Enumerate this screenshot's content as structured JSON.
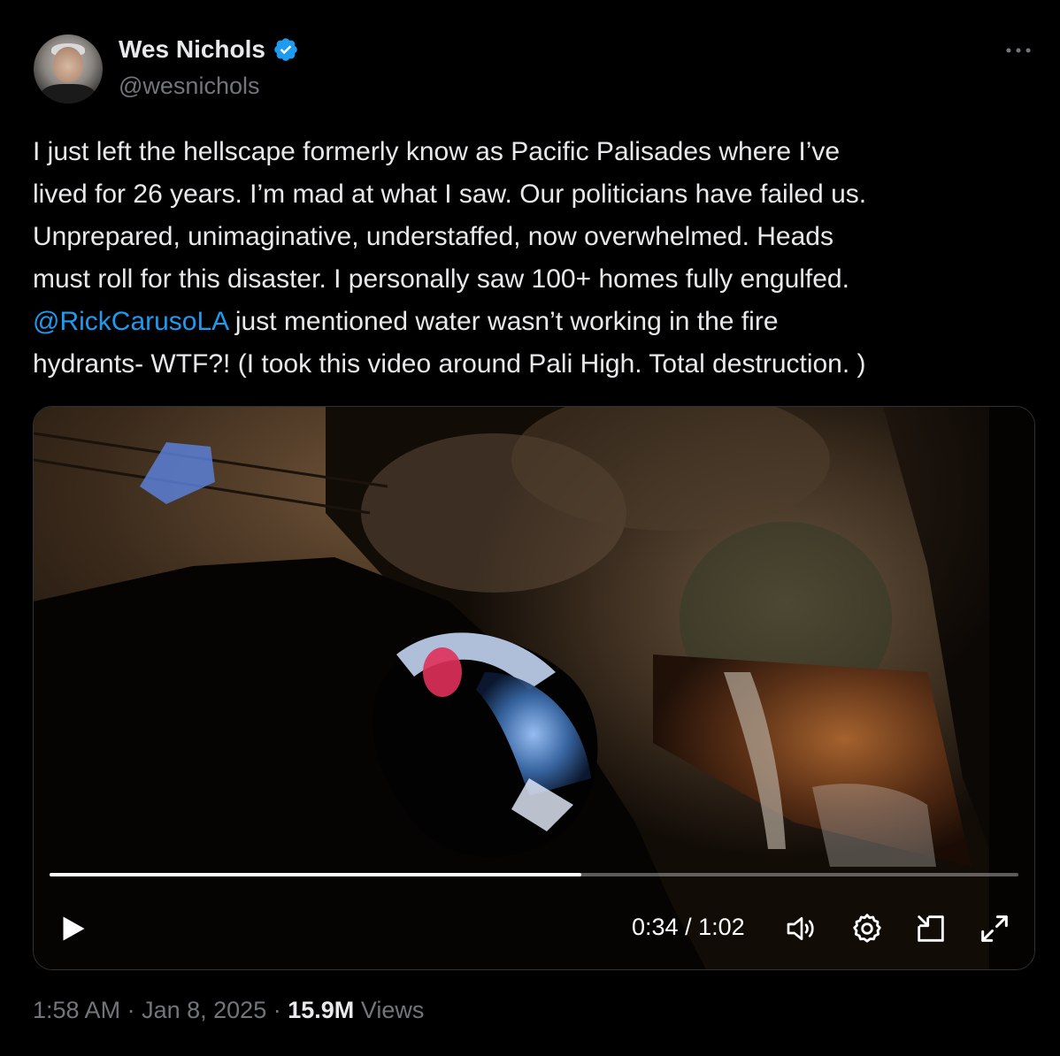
{
  "author": {
    "name": "Wes Nichols",
    "handle": "@wesnichols",
    "verified": true
  },
  "tweet": {
    "lines": [
      "I just left the hellscape formerly know as Pacific Palisades where I’ve",
      "lived for 26 years. I’m mad at what I saw. Our politicians have failed us.",
      "Unprepared, unimaginative, understaffed, now overwhelmed. Heads",
      "must roll for this disaster. I personally saw 100+ homes fully engulfed."
    ],
    "mention": "@RickCarusoLA",
    "line5_rest": " just mentioned water wasn’t working in the fire",
    "line6": "hydrants- WTF?!   (I took this video around Pali High. Total destruction. )"
  },
  "video": {
    "progress_fraction": 0.549,
    "current_time": "0:34",
    "separator": "/",
    "duration": "1:02"
  },
  "footer": {
    "time": "1:58 AM",
    "dot1": "·",
    "date": "Jan 8, 2025",
    "dot2": "·",
    "views_count": "15.9M",
    "views_label": "Views"
  },
  "icons": {
    "more": "more-horizontal-icon",
    "verified": "verified-badge-icon",
    "play": "play-icon",
    "volume": "volume-icon",
    "settings": "settings-gear-icon",
    "pip": "picture-in-picture-icon",
    "fullscreen": "fullscreen-icon"
  },
  "colors": {
    "background": "#000000",
    "text": "#e7e9ea",
    "secondary": "#71767b",
    "link": "#1d9bf0"
  }
}
